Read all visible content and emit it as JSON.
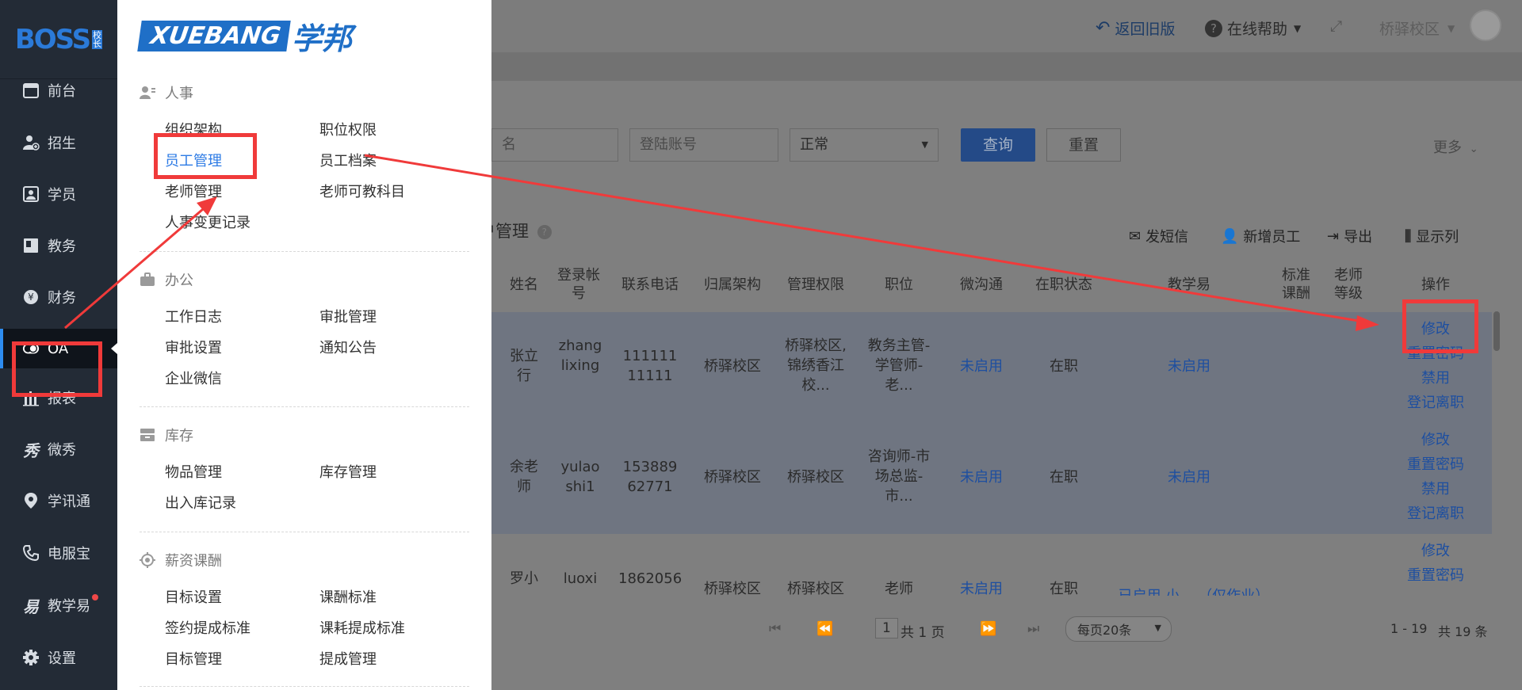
{
  "sidebar": {
    "logo_text": "BOSS",
    "logo_badge": "校长",
    "items": [
      {
        "label": "前台",
        "icon": "calendar-icon"
      },
      {
        "label": "招生",
        "icon": "user-add-icon"
      },
      {
        "label": "学员",
        "icon": "student-card-icon"
      },
      {
        "label": "教务",
        "icon": "book-icon"
      },
      {
        "label": "财务",
        "icon": "yen-icon"
      },
      {
        "label": "OA",
        "icon": "toggle-icon"
      },
      {
        "label": "报表",
        "icon": "bar-chart-icon"
      },
      {
        "label": "微秀",
        "icon": "xiu-icon"
      },
      {
        "label": "学讯通",
        "icon": "location-icon"
      },
      {
        "label": "电服宝",
        "icon": "phone-icon"
      },
      {
        "label": "教学易",
        "icon": "yi-icon"
      },
      {
        "label": "设置",
        "icon": "gear-icon"
      }
    ]
  },
  "menu": {
    "brand_en": "XUEBANG",
    "brand_cn": "学邦",
    "sections": [
      {
        "title": "人事",
        "icon": "person-icon",
        "items": [
          "组织架构",
          "职位权限",
          "员工管理",
          "员工档案",
          "老师管理",
          "老师可教科目",
          "人事变更记录"
        ]
      },
      {
        "title": "办公",
        "icon": "briefcase-icon",
        "items": [
          "工作日志",
          "审批管理",
          "审批设置",
          "通知公告",
          "企业微信"
        ]
      },
      {
        "title": "库存",
        "icon": "inventory-icon",
        "items": [
          "物品管理",
          "库存管理",
          "出入库记录"
        ]
      },
      {
        "title": "薪资课酬",
        "icon": "target-icon",
        "items": [
          "目标设置",
          "课酬标准",
          "签约提成标准",
          "课耗提成标准",
          "目标管理",
          "提成管理"
        ]
      }
    ]
  },
  "topbar": {
    "back_old": "返回旧版",
    "help": "在线帮助",
    "campus": "桥驿校区"
  },
  "filter": {
    "name_placeholder": "名",
    "account_placeholder": "登陆账号",
    "status_value": "正常",
    "query_label": "查询",
    "reset_label": "重置",
    "more_label": "更多"
  },
  "table": {
    "title": "户管理",
    "tools": [
      "发短信",
      "新增员工",
      "导出",
      "显示列"
    ],
    "headers": [
      "姓名",
      "登录帐号",
      "联系电话",
      "归属架构",
      "管理权限",
      "职位",
      "微沟通",
      "在职状态",
      "教学易",
      "标准课酬",
      "老师等级",
      "操作"
    ],
    "rows": [
      {
        "name": "张立行",
        "account": "zhanglixing",
        "phone": "11111111111",
        "org": "桥驿校区",
        "perm": "桥驿校区,锦绣香江校...",
        "position": "教务主管-学管师-老...",
        "wechat": "未启用",
        "status": "在职",
        "jxy": "未启用",
        "ops": [
          "修改",
          "重置密码",
          "禁用",
          "登记离职"
        ]
      },
      {
        "name": "余老师",
        "account": "yulaoshi1",
        "phone": "15388962771",
        "org": "桥驿校区",
        "perm": "桥驿校区",
        "position": "咨询师-市场总监-市...",
        "wechat": "未启用",
        "status": "在职",
        "jxy": "未启用",
        "ops": [
          "修改",
          "重置密码",
          "禁用",
          "登记离职"
        ]
      },
      {
        "name": "罗小",
        "account": "luoxi",
        "phone": "1862056",
        "org": "桥驿校区",
        "perm": "桥驿校区",
        "position": "老师",
        "wechat": "未启用",
        "status": "在职",
        "jxy": "已启用 小 ...（仅作业）",
        "ops": [
          "修改",
          "重置密码"
        ]
      }
    ]
  },
  "pager": {
    "page": "1",
    "total_pages": "共 1 页",
    "page_size": "每页20条",
    "range": "1 - 19",
    "total": "共 19 条"
  },
  "colors": {
    "annotation": "#f03a3a",
    "accent": "#2d7be5",
    "sidebar_bg": "#232b36"
  }
}
